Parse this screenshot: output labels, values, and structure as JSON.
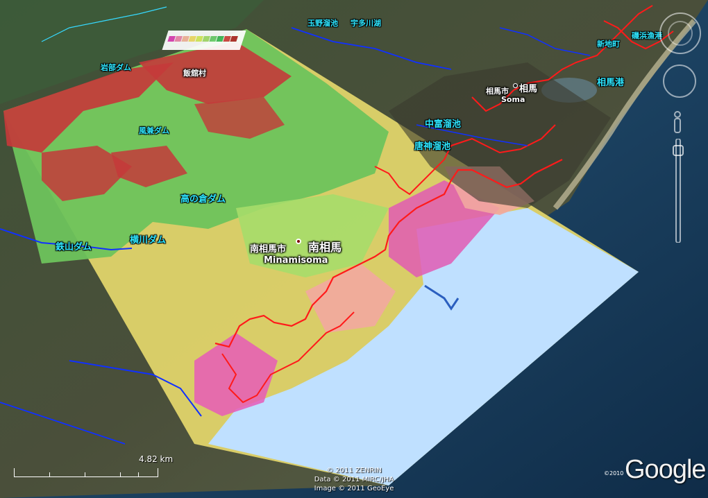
{
  "place_labels": {
    "tamano": "玉野溜池",
    "udagawa": "宇多川湖",
    "isohama": "磯浜漁港",
    "shinchi": "新地町",
    "iwabe": "岩部ダム",
    "iitate": "飯舘村",
    "somashi": "相馬市",
    "soma": "相馬",
    "soma_en": "Soma",
    "somako": "相馬港",
    "nakatomi": "中富溜池",
    "karakami": "唐神溜池",
    "kazakoshi": "風兼ダム",
    "takanokura": "高の倉ダム",
    "yokokawa": "横川ダム",
    "tetsuyama": "鉄山ダム",
    "minamisomashi": "南相馬市",
    "minamisoma": "南相馬",
    "minamisoma_en": "Minamisoma"
  },
  "scale": {
    "label": "4.82 km"
  },
  "credits": {
    "line1": "© 2011 ZENRIN",
    "line2": "Data © 2011 MIRC/JHA",
    "line3": "Image © 2011 GeoEye"
  },
  "brand": {
    "logo": "Google",
    "year": "©2010"
  },
  "legend_colors": [
    "#e044b8",
    "#f08ab0",
    "#f7b8a0",
    "#f5e06a",
    "#d8ef60",
    "#a8e070",
    "#70d070",
    "#40b858",
    "#d04040",
    "#b02828"
  ],
  "colors": {
    "ocean": "#1d4466",
    "overlay_sea": "#bfe0ff",
    "flood_line": "#ff1a1a",
    "river": "#1030ff",
    "label": "#2ee6ff"
  }
}
